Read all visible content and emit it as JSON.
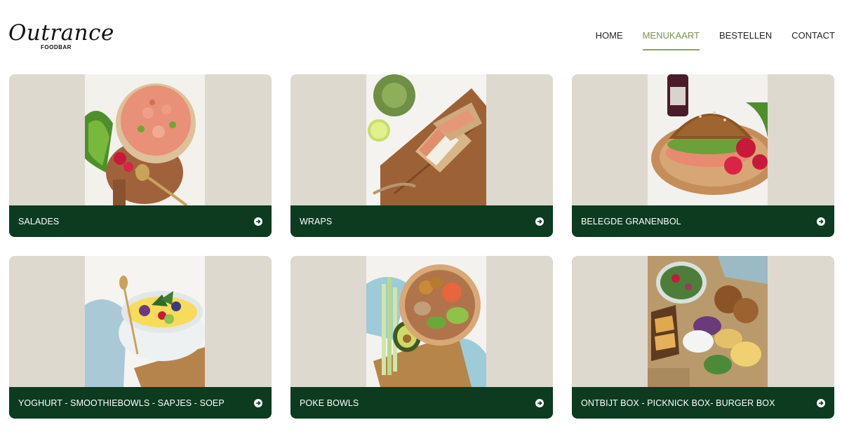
{
  "brand": {
    "name": "Outrance",
    "subtitle": "FOODBAR"
  },
  "nav": {
    "items": [
      {
        "label": "HOME"
      },
      {
        "label": "MENUKAART"
      },
      {
        "label": "BESTELLEN"
      },
      {
        "label": "CONTACT"
      }
    ],
    "active": "MENUKAART"
  },
  "categories": [
    {
      "label": "SALADES",
      "photo": "salad-bowl-photo"
    },
    {
      "label": "WRAPS",
      "photo": "wrap-photo"
    },
    {
      "label": "BELEGDE GRANENBOL",
      "photo": "sandwich-photo"
    },
    {
      "label": "YOGHURT - SMOOTHIEBOWLS - SAPJES - SOEP",
      "photo": "yoghurt-bowl-photo"
    },
    {
      "label": "POKE BOWLS",
      "photo": "poke-bowl-photo"
    },
    {
      "label": "ONTBIJT BOX - PICKNICK BOX- BURGER BOX",
      "photo": "box-photo"
    }
  ],
  "colors": {
    "accent": "#8fa35e",
    "card_bar": "#0c3b1f",
    "card_background": "#ddd9ce"
  }
}
